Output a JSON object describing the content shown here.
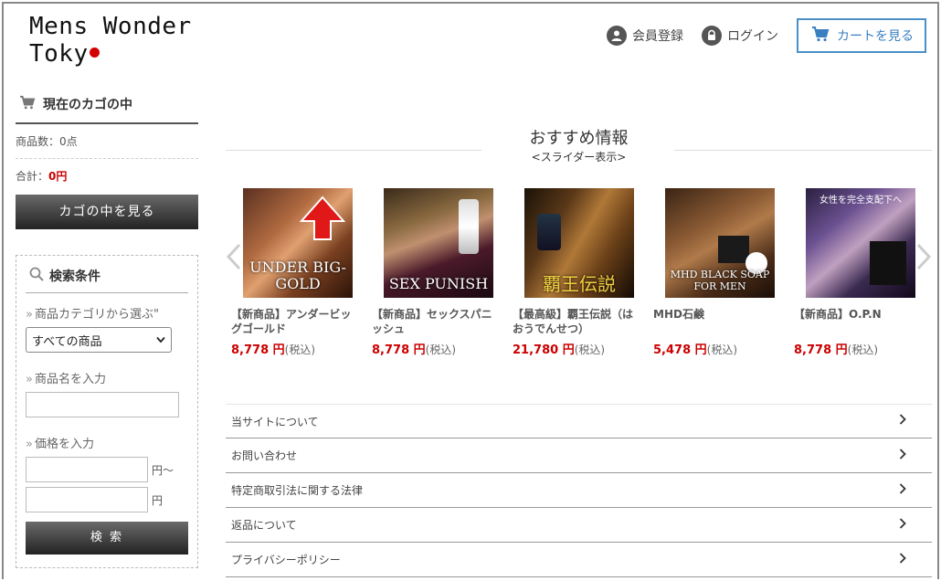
{
  "header": {
    "logo_line1": "Mens Wonder",
    "logo_line2": "Toky",
    "member_label": "会員登録",
    "login_label": "ログイン",
    "cart_label": "カートを見る"
  },
  "sidebar": {
    "basket_title": "現在のカゴの中",
    "item_count": "商品数：0点",
    "total_label": "合計：",
    "total_value": "0円",
    "view_cart": "カゴの中を見る",
    "search_title": "検索条件",
    "category_label": "商品カテゴリから選ぶ\"",
    "category_selected": "すべての商品",
    "name_label": "商品名を入力",
    "price_label": "価格を入力",
    "price_from_suffix": "円～",
    "price_to_suffix": "円",
    "search_button": "検 索"
  },
  "main": {
    "rec_title": "おすすめ情報",
    "rec_sub": "<スライダー表示>",
    "products": [
      {
        "name": "【新商品】アンダービッグゴールド",
        "price": "8,778 円",
        "tax": "(税込)",
        "caption": "UNDER BIG-GOLD"
      },
      {
        "name": "【新商品】セックスパニッシュ",
        "price": "8,778 円",
        "tax": "(税込)",
        "caption": "SEX PUNISH"
      },
      {
        "name": "【最高級】覇王伝説（はおうでんせつ）",
        "price": "21,780 円",
        "tax": "(税込)",
        "caption": "覇王伝説"
      },
      {
        "name": "MHD石鹸",
        "price": "5,478 円",
        "tax": "(税込)",
        "caption": "MHD BLACK SOAP FOR MEN"
      },
      {
        "name": "【新商品】O.P.N",
        "price": "8,778 円",
        "tax": "(税込)",
        "caption": "女性を完全支配下へ"
      }
    ],
    "links": [
      "当サイトについて",
      "お問い合わせ",
      "特定商取引法に関する法律",
      "返品について",
      "プライバシーポリシー"
    ]
  },
  "colors": {
    "accent_blue": "#3a7fc0",
    "price_red": "#cc0000",
    "logo_dot": "#d30000"
  }
}
